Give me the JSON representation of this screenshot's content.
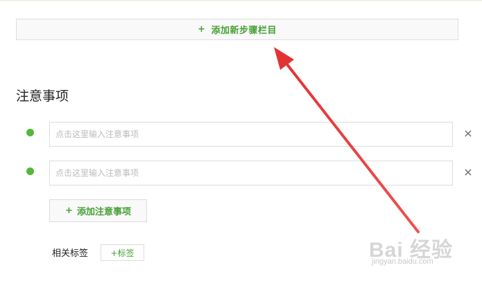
{
  "add_step_button": {
    "plus": "+",
    "label": "添加新步骤栏目"
  },
  "notes_section": {
    "title": "注意事项",
    "items": [
      {
        "value": "",
        "placeholder": "点击这里输入注意事项",
        "remove_icon": "×"
      },
      {
        "value": "",
        "placeholder": "点击这里输入注意事项",
        "remove_icon": "×"
      }
    ],
    "add_button": {
      "plus": "+",
      "label": "添加注意事项"
    }
  },
  "tags": {
    "label": "相关标签",
    "add_tag_label": "+标签"
  },
  "watermark": {
    "main": "Bai 经验",
    "sub": "jingyan.baidu.com"
  },
  "colors": {
    "accent_green": "#46a135",
    "dot_green": "#52b93a",
    "arrow_red": "#e8393a"
  }
}
